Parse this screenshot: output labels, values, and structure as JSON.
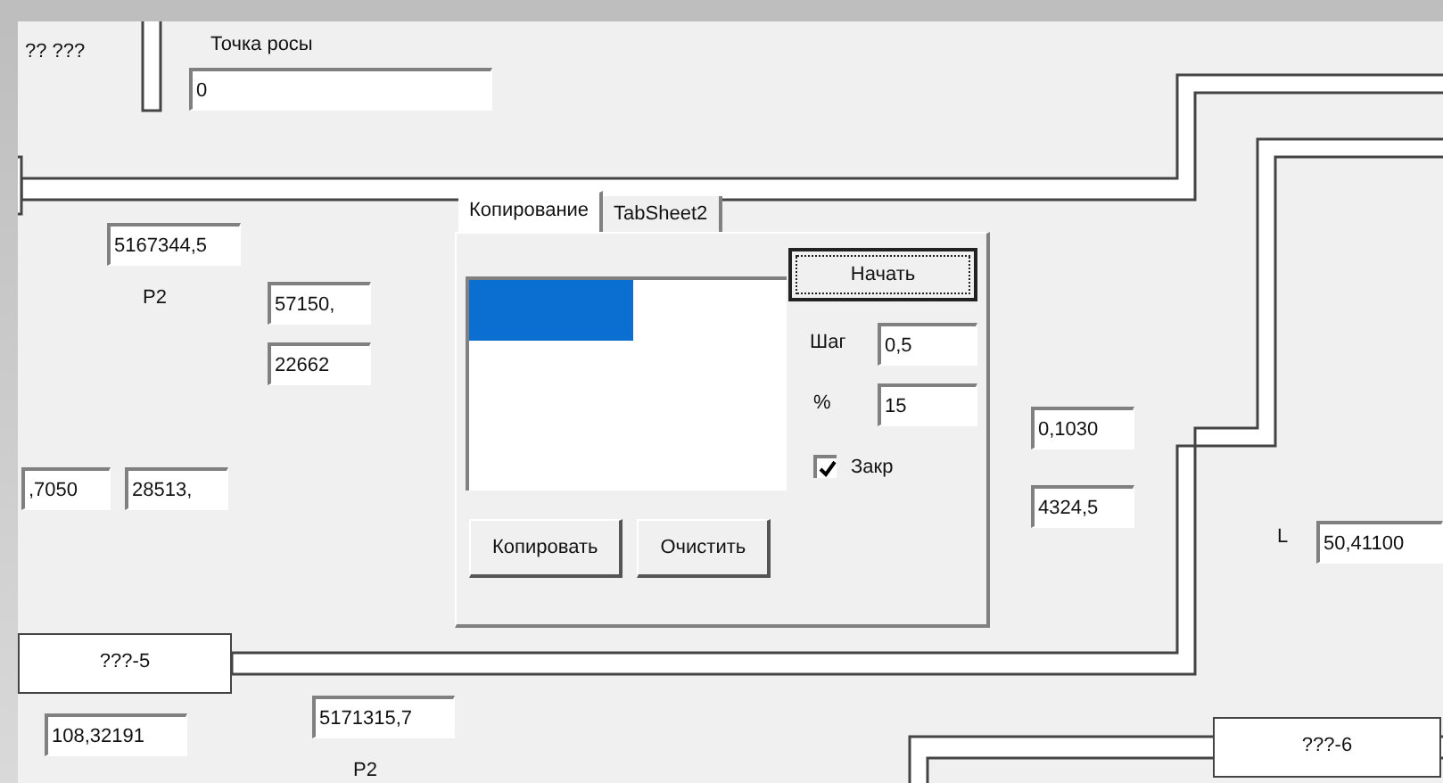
{
  "labels": [
    {
      "text": "?? ???"
    },
    {
      "text": "Точка росы"
    },
    {
      "text": "P2"
    },
    {
      "text": "L"
    },
    {
      "text": "P2"
    }
  ],
  "fields": [
    {
      "value": "0"
    },
    {
      "value": "5167344,5"
    },
    {
      "value": "57150,"
    },
    {
      "value": "22662"
    },
    {
      "value": ",7050"
    },
    {
      "value": "28513,"
    },
    {
      "value": "0,1030"
    },
    {
      "value": "4324,5"
    },
    {
      "value": "50,41100"
    },
    {
      "value": "108,32191"
    },
    {
      "value": "5171315,7"
    }
  ],
  "node_boxes": [
    {
      "label": "???-5"
    },
    {
      "label": "???-6"
    }
  ],
  "tab_panel": {
    "tabs": [
      {
        "label": "Копирование",
        "selected": true
      },
      {
        "label": "TabSheet2",
        "selected": false
      }
    ],
    "list": {
      "items": [
        {
          "selected": true
        }
      ]
    },
    "start_button": {
      "label": "Начать",
      "focused": true
    },
    "step": {
      "label": "Шаг",
      "value": "0,5"
    },
    "percent": {
      "label": "%",
      "value": "15"
    },
    "closed": {
      "label": "Закр",
      "checked": true
    },
    "buttons": [
      {
        "label": "Копировать"
      },
      {
        "label": "Очистить"
      }
    ]
  }
}
